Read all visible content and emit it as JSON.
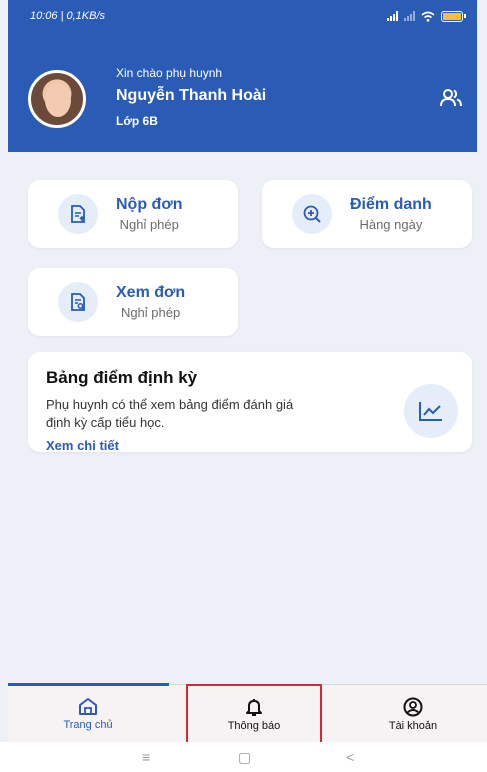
{
  "status_bar": {
    "time": "10:06 | 0,1KB/s"
  },
  "header": {
    "greeting": "Xin chào phụ huynh",
    "parent_name": "Nguyễn Thanh Hoài",
    "class_label": "Lớp 6B",
    "bg_color": "#2a5bb5"
  },
  "actions": [
    {
      "title": "Nộp đơn",
      "subtitle": "Nghỉ phép",
      "icon": "document-upload-icon"
    },
    {
      "title": "Điểm danh",
      "subtitle": "Hàng ngày",
      "icon": "zoom-plus-icon"
    },
    {
      "title": "Xem đơn",
      "subtitle": "Nghỉ phép",
      "icon": "document-search-icon"
    }
  ],
  "report_card": {
    "title": "Bảng điểm định kỳ",
    "description": "Phụ huynh có thể xem bảng điểm đánh giá định kỳ cấp tiểu học.",
    "link": "Xem chi tiết",
    "icon": "line-chart-icon"
  },
  "bottom_nav": {
    "items": [
      {
        "label": "Trang chủ",
        "icon": "home-icon",
        "active": true
      },
      {
        "label": "Thông báo",
        "icon": "bell-icon",
        "active": false
      },
      {
        "label": "Tài khoản",
        "icon": "account-icon",
        "active": false
      }
    ]
  },
  "system_nav": {
    "menu": "≡",
    "home": "▢",
    "back": "<"
  },
  "colors": {
    "accent": "#2a5bb5",
    "highlight": "#d6283d"
  }
}
